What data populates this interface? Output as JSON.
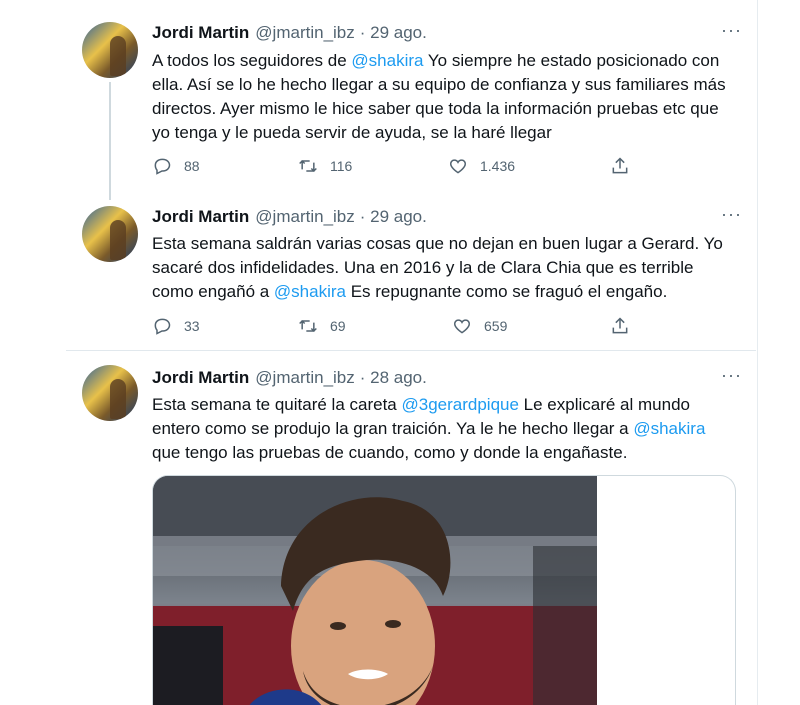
{
  "tweets": [
    {
      "name": "Jordi Martin",
      "handle": "@jmartin_ibz",
      "date": "· 29 ago.",
      "text_parts": [
        "A todos los seguidores de ",
        "@shakira",
        " Yo siempre he estado posicionado con ella. Así se lo he hecho llegar a su equipo de confianza y sus familiares más directos. Ayer mismo le hice saber que toda la información pruebas etc que yo tenga y le pueda servir de ayuda, se la haré llegar"
      ],
      "replies": "88",
      "retweets": "116",
      "likes": "1.436"
    },
    {
      "name": "Jordi Martin",
      "handle": "@jmartin_ibz",
      "date": "· 29 ago.",
      "text_parts": [
        "Esta semana saldrán varias cosas que no dejan en buen lugar a Gerard. Yo sacaré dos infidelidades. Una en 2016 y la de Clara Chia que es terrible como engañó a ",
        "@shakira",
        " Es repugnante como se fraguó el engaño."
      ],
      "replies": "33",
      "retweets": "69",
      "likes": "659"
    },
    {
      "name": "Jordi Martin",
      "handle": "@jmartin_ibz",
      "date": "· 28 ago.",
      "text_parts": [
        "Esta semana te quitaré la careta ",
        "@3gerardpique",
        " Le explicaré al mundo entero como se produjo la gran traición. Ya le he hecho llegar a ",
        "@shakira",
        " que tengo las pruebas de cuando, como y donde la engañaste."
      ]
    }
  ],
  "icons": [
    "reply-icon",
    "retweet-icon",
    "like-icon",
    "share-icon",
    "more-icon"
  ]
}
